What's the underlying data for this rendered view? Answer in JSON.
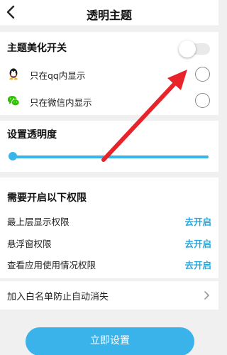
{
  "header": {
    "title": "透明主题"
  },
  "theme_section": {
    "title": "主题美化开关",
    "toggle_on": false,
    "options": [
      {
        "label": "只在qq内显示",
        "icon": "qq-icon",
        "selected": false
      },
      {
        "label": "只在微信内显示",
        "icon": "wechat-icon",
        "selected": false
      }
    ]
  },
  "transparency": {
    "title": "设置透明度",
    "level": 0
  },
  "permissions": {
    "title": "需要开启以下权限",
    "items": [
      {
        "label": "最上层显示权限",
        "action": "去开启"
      },
      {
        "label": "悬浮窗权限",
        "action": "去开启"
      },
      {
        "label": "查看应用使用情况权限",
        "action": "去开启"
      }
    ]
  },
  "whitelist": {
    "label": "加入白名单防止自动消失"
  },
  "cta": {
    "label": "立即设置"
  },
  "colors": {
    "accent": "#36b6ea",
    "link": "#28a7e0",
    "arrow": "#e8242a"
  }
}
